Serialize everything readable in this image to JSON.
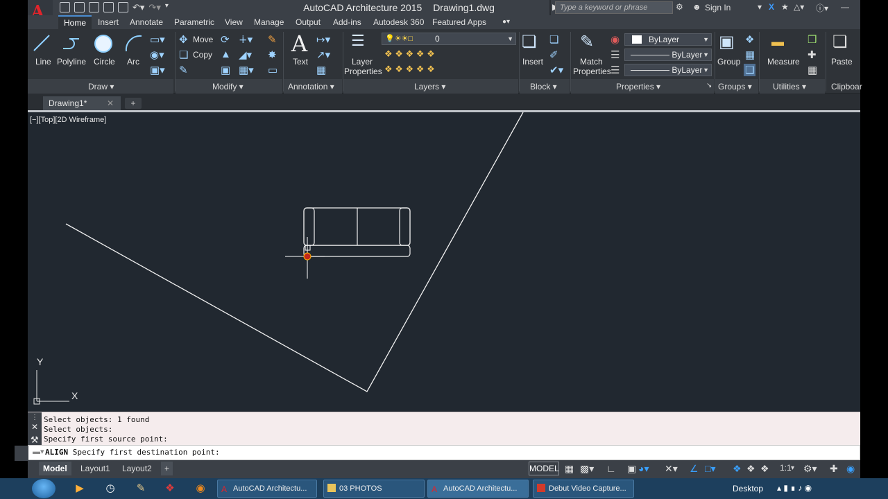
{
  "titlebar": {
    "app_name": "AutoCAD Architecture 2015",
    "file_name": "Drawing1.dwg",
    "search_placeholder": "Type a keyword or phrase",
    "sign_in": "Sign In"
  },
  "ribbon_tabs": [
    "Home",
    "Insert",
    "Annotate",
    "Parametric",
    "View",
    "Manage",
    "Output",
    "Add-ins",
    "Autodesk 360",
    "Featured Apps"
  ],
  "ribbon": {
    "draw": {
      "line": "Line",
      "polyline": "Polyline",
      "circle": "Circle",
      "arc": "Arc",
      "panel": "Draw"
    },
    "modify": {
      "move": "Move",
      "copy": "Copy",
      "panel": "Modify"
    },
    "annotation": {
      "text": "Text",
      "panel": "Annotation"
    },
    "layers": {
      "layer_properties_1": "Layer",
      "layer_properties_2": "Properties",
      "current_layer": "0",
      "panel": "Layers"
    },
    "block": {
      "insert": "Insert",
      "panel": "Block"
    },
    "properties": {
      "match_1": "Match",
      "match_2": "Properties",
      "color": "ByLayer",
      "linetype": "ByLayer",
      "lineweight": "ByLayer",
      "panel": "Properties"
    },
    "groups": {
      "group": "Group",
      "panel": "Groups"
    },
    "utilities": {
      "measure": "Measure",
      "panel": "Utilities"
    },
    "clipboard": {
      "paste": "Paste",
      "panel": "Clipboar"
    }
  },
  "doc_tabs": {
    "active": "Drawing1*"
  },
  "viewport": {
    "label": "[−][Top][2D Wireframe]"
  },
  "ucs": {
    "y": "Y",
    "x": "X"
  },
  "command": {
    "history": [
      "Select objects: 1 found",
      "Select objects:",
      "Specify first source point:"
    ],
    "prompt_cmd": "ALIGN",
    "prompt_text": "Specify first destination point:"
  },
  "status": {
    "layout_tabs": [
      "Model",
      "Layout1",
      "Layout2"
    ],
    "model": "MODEL",
    "scale": "1:1"
  },
  "taskbar": {
    "windows": [
      "AutoCAD Architectu...",
      "03 PHOTOS",
      "AutoCAD Architectu...",
      "Debut Video Capture..."
    ],
    "desktop": "Desktop"
  },
  "colors": {
    "canvas": "#212830",
    "ribbon": "#2f3338",
    "accent": "#4a8cd0",
    "linework": "#ffffff",
    "cursor_marker": "#c0271c"
  }
}
